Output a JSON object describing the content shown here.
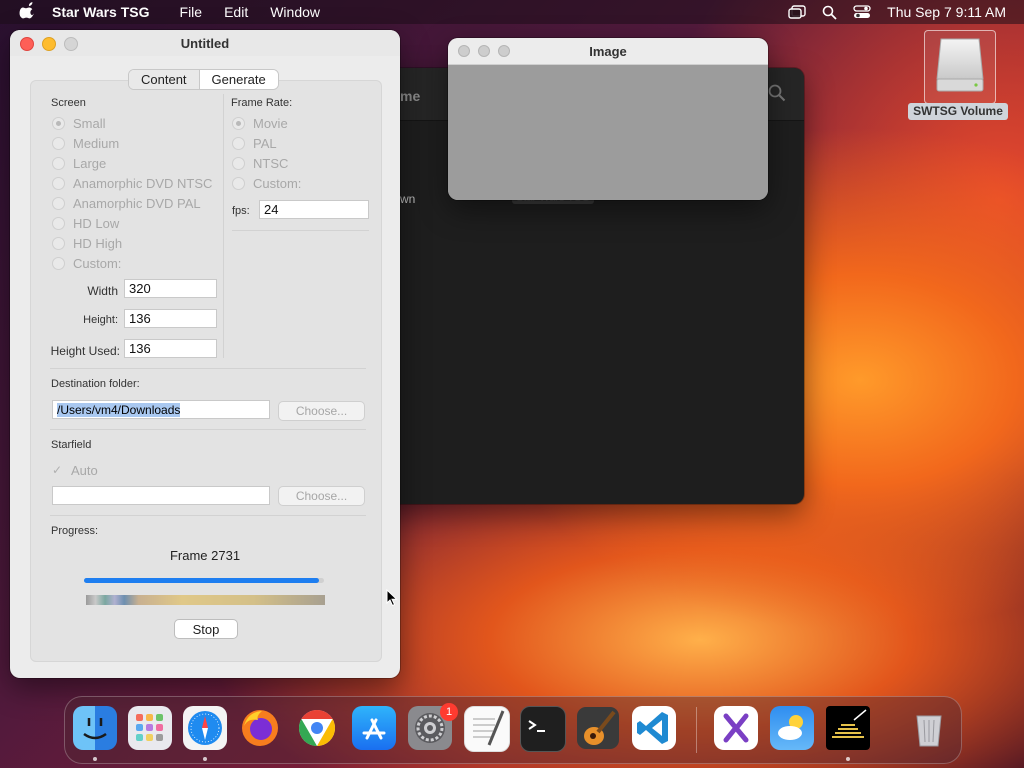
{
  "menubar": {
    "app_name": "Star Wars TSG",
    "menus": [
      "File",
      "Edit",
      "Window"
    ],
    "clock": "Thu Sep 7  9:11 AM"
  },
  "desktop": {
    "drive_label": "SWTSG Volume"
  },
  "background_window": {
    "header_fragment": "me",
    "sidebar_fragment": "wn",
    "overlap_fragment": "Star Wars TSG"
  },
  "image_window": {
    "title": "Image"
  },
  "main_window": {
    "title": "Untitled",
    "tabs": [
      {
        "label": "Content",
        "active": false
      },
      {
        "label": "Generate",
        "active": true
      }
    ],
    "screen": {
      "label": "Screen",
      "options": [
        "Small",
        "Medium",
        "Large",
        "Anamorphic DVD NTSC",
        "Anamorphic DVD PAL",
        "HD Low",
        "HD High",
        "Custom:"
      ],
      "selected": "Small",
      "width_label": "Width",
      "width_value": "320",
      "height_label": "Height:",
      "height_value": "136",
      "height_used_label": "Height Used:",
      "height_used_value": "136"
    },
    "frame_rate": {
      "label": "Frame Rate:",
      "options": [
        "Movie",
        "PAL",
        "NTSC",
        "Custom:"
      ],
      "selected": "Movie",
      "fps_label": "fps:",
      "fps_value": "24"
    },
    "destination": {
      "label": "Destination folder:",
      "path": "/Users/vm4/Downloads",
      "choose_label": "Choose..."
    },
    "starfield": {
      "label": "Starfield",
      "auto_label": "Auto",
      "auto_checked": true,
      "path": "",
      "choose_label": "Choose..."
    },
    "progress": {
      "label": "Progress:",
      "status": "Frame 2731",
      "fraction": 0.98,
      "stop_label": "Stop"
    }
  },
  "dock": {
    "settings_badge": "1"
  }
}
